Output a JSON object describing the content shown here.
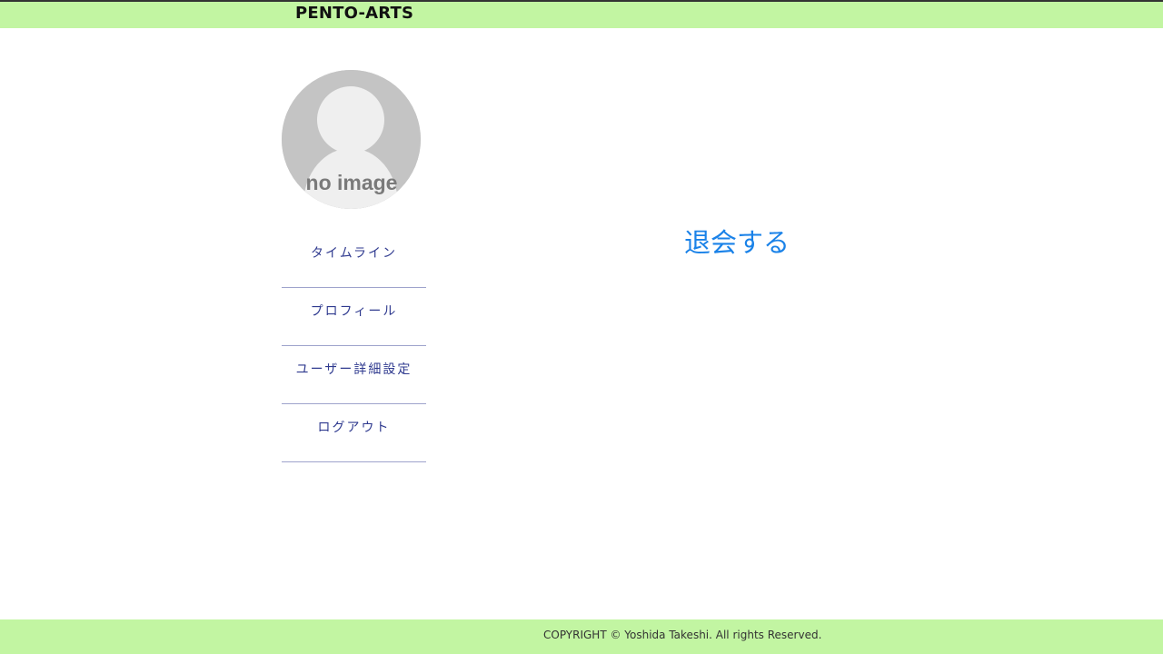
{
  "header": {
    "site_title": "PENTO-ARTS"
  },
  "avatar": {
    "label": "no image"
  },
  "sidebar": {
    "items": [
      {
        "label": "タイムライン"
      },
      {
        "label": "プロフィール"
      },
      {
        "label": "ユーザー詳細設定"
      },
      {
        "label": "ログアウト"
      }
    ]
  },
  "main": {
    "withdraw_label": "退会する"
  },
  "footer": {
    "copyright": "COPYRIGHT © Yoshida Takeshi. All rights Reserved."
  },
  "colors": {
    "header_bg": "#c2f5a2",
    "footer_bg": "#c2f5a2",
    "link": "#1a82e8",
    "nav_text": "#2f3a8f"
  }
}
